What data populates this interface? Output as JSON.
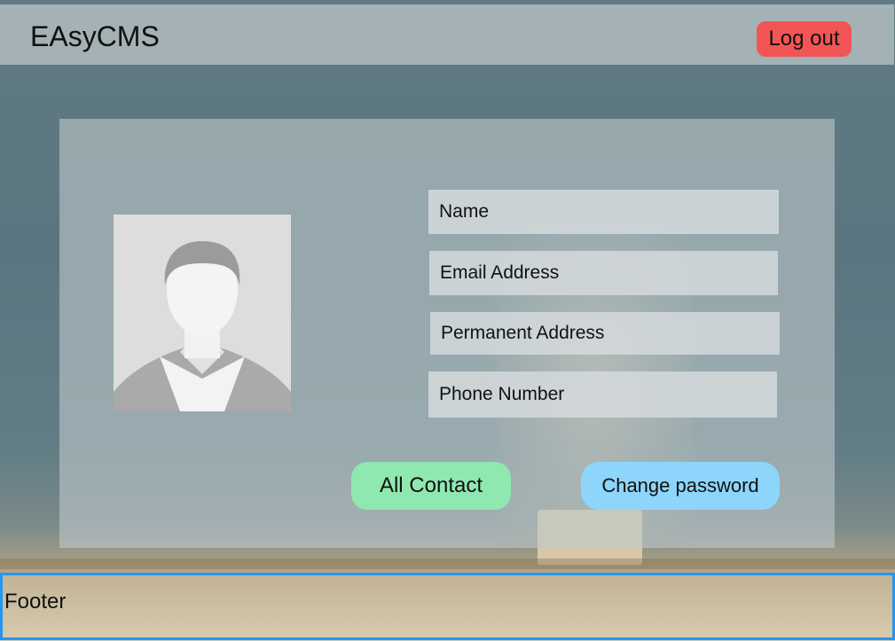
{
  "header": {
    "brand": "EAsyCMS",
    "logout_label": "Log out"
  },
  "profile": {
    "fields": {
      "name": "Name",
      "email": "Email Address",
      "permanent_address": "Permanent Address",
      "phone": "Phone Number"
    },
    "buttons": {
      "all_contact": "All Contact",
      "change_password": "Change password"
    }
  },
  "footer": {
    "label": "Footer"
  },
  "colors": {
    "logout": "#f25555",
    "all_contact": "#8ee8b0",
    "change_password": "#8dd5fb",
    "footer_border": "#2496f0"
  },
  "icons": {
    "avatar": "user-silhouette-icon"
  }
}
